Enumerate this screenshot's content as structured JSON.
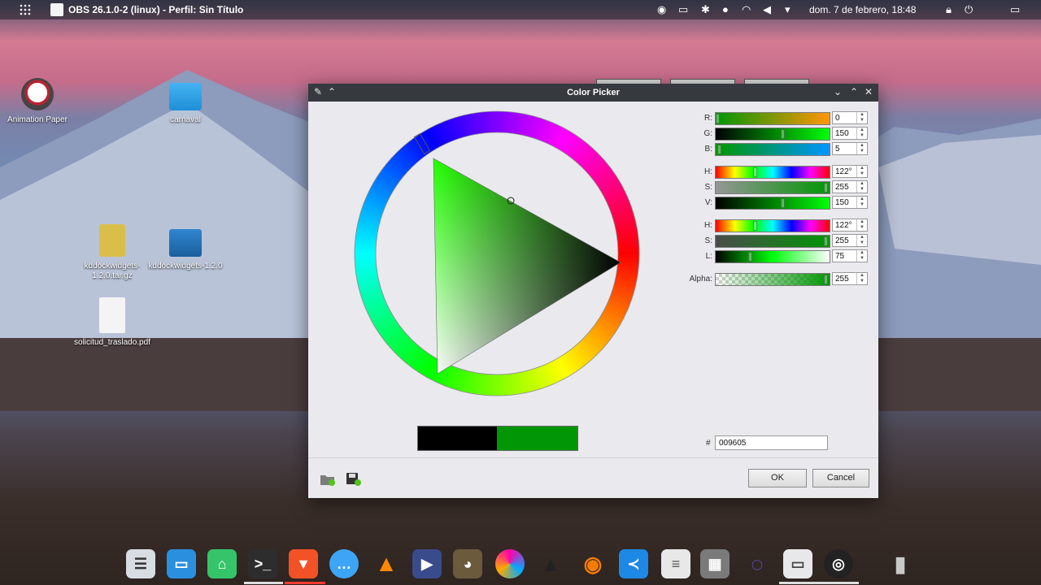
{
  "topbar": {
    "app_title": "OBS 26.1.0-2 (linux) - Perfil: Sin Título",
    "clock": "dom. 7 de febrero, 18:48"
  },
  "desktop_icons": [
    {
      "label": "Animation Paper",
      "icon": "animation-paper-icon"
    },
    {
      "label": "carnaval",
      "icon": "folder-icon"
    },
    {
      "label": "kddockwidgets-1.2.0.tar.gz",
      "icon": "archive-icon"
    },
    {
      "label": "kddockwidgets-1.2.0",
      "icon": "folder-image-icon"
    },
    {
      "label": "solicitud_traslado.pdf",
      "icon": "document-icon"
    }
  ],
  "dialog": {
    "title": "Color Picker",
    "rgb": [
      {
        "label": "R:",
        "value": "0"
      },
      {
        "label": "G:",
        "value": "150"
      },
      {
        "label": "B:",
        "value": "5"
      }
    ],
    "hsv": [
      {
        "label": "H:",
        "value": "122°"
      },
      {
        "label": "S:",
        "value": "255"
      },
      {
        "label": "V:",
        "value": "150"
      }
    ],
    "hsl": [
      {
        "label": "H:",
        "value": "122°"
      },
      {
        "label": "S:",
        "value": "255"
      },
      {
        "label": "L:",
        "value": "75"
      }
    ],
    "alpha": {
      "label": "Alpha:",
      "value": "255"
    },
    "hex_label": "#",
    "hex_value": "009605",
    "ok_label": "OK",
    "cancel_label": "Cancel",
    "current_color": "#009605",
    "previous_color": "#000000"
  },
  "dock": {
    "apps": [
      "files-manager",
      "folder",
      "android-store",
      "terminal",
      "brave",
      "chat",
      "vlc",
      "kdenlive",
      "gimp",
      "krita",
      "inkscape",
      "blender",
      "vscode",
      "text-editor",
      "calculator",
      "graph-tool",
      "window-app",
      "obs",
      "trash"
    ]
  }
}
